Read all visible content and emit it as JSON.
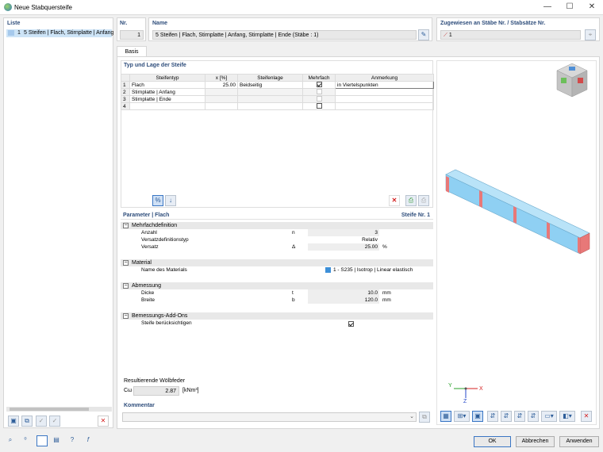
{
  "window": {
    "title": "Neue Stabquersteife",
    "minimize": "—",
    "maximize": "☐",
    "close": "✕"
  },
  "list": {
    "header": "Liste",
    "items": [
      {
        "num": "1",
        "label": "5 Steifen | Flach, Stirnplatte | Anfang"
      }
    ]
  },
  "nr": {
    "header": "Nr.",
    "value": "1"
  },
  "name": {
    "header": "Name",
    "value": "5 Steifen | Flach, Stirnplatte | Anfang, Stirnplatte | Ende (Stäbe : 1)"
  },
  "assigned": {
    "header": "Zugewiesen an Stäbe Nr. / Stabsätze Nr.",
    "value": "1"
  },
  "tabs": [
    {
      "label": "Basis"
    }
  ],
  "type_table": {
    "header": "Typ und Lage der Steife",
    "columns": [
      "Steifentyp",
      "x [%]",
      "Steifenlage",
      "Mehrfach",
      "Anmerkung"
    ],
    "rows": [
      {
        "n": "1",
        "type": "Flach",
        "x": "25.00",
        "lage": "Beidseitig",
        "mehr": true,
        "note": "in Viertelspunkten"
      },
      {
        "n": "2",
        "type": "Stirnplatte | Anfang",
        "x": "",
        "lage": "",
        "mehr": false,
        "note": ""
      },
      {
        "n": "3",
        "type": "Stirnplatte | Ende",
        "x": "",
        "lage": "",
        "mehr": false,
        "note": ""
      },
      {
        "n": "4",
        "type": "",
        "x": "",
        "lage": "",
        "mehr": false,
        "note": ""
      }
    ]
  },
  "params": {
    "header": "Parameter | Flach",
    "stiffener": "Steife Nr. 1",
    "sections": [
      {
        "title": "Mehrfachdefinition",
        "rows": [
          {
            "label": "Anzahl",
            "sym": "n",
            "value": "3",
            "unit": ""
          },
          {
            "label": "Versatzdefinitionstyp",
            "sym": "",
            "value": "Relativ",
            "unit": ""
          },
          {
            "label": "Versatz",
            "sym": "Δ",
            "value": "25.00",
            "unit": "%"
          }
        ]
      },
      {
        "title": "Material",
        "rows": [
          {
            "label": "Name des Materials",
            "sym": "",
            "value": "1 - S235 | Isotrop | Linear elastisch",
            "unit": ""
          }
        ]
      },
      {
        "title": "Abmessung",
        "rows": [
          {
            "label": "Dicke",
            "sym": "t",
            "value": "10.0",
            "unit": "mm"
          },
          {
            "label": "Breite",
            "sym": "b",
            "value": "120.0",
            "unit": "mm"
          }
        ]
      },
      {
        "title": "Bemessungs-Add-Ons",
        "rows": [
          {
            "label": "Steife berücksichtigen",
            "sym": "",
            "value": "",
            "unit": ""
          }
        ]
      }
    ]
  },
  "warping": {
    "header": "Resultierende Wölbfeder",
    "sym": "Cω",
    "value": "2.87",
    "unit": "[kNm³]"
  },
  "comment": {
    "header": "Kommentar",
    "value": ""
  },
  "axes": {
    "x": "X",
    "y": "Y",
    "z": "Z"
  },
  "buttons": {
    "ok": "OK",
    "cancel": "Abbrechen",
    "apply": "Anwenden"
  },
  "colors": {
    "accent": "#2e4d7b",
    "beam": "#8fd0f3",
    "stiffener": "#e87878",
    "close_red": "#d42020"
  }
}
